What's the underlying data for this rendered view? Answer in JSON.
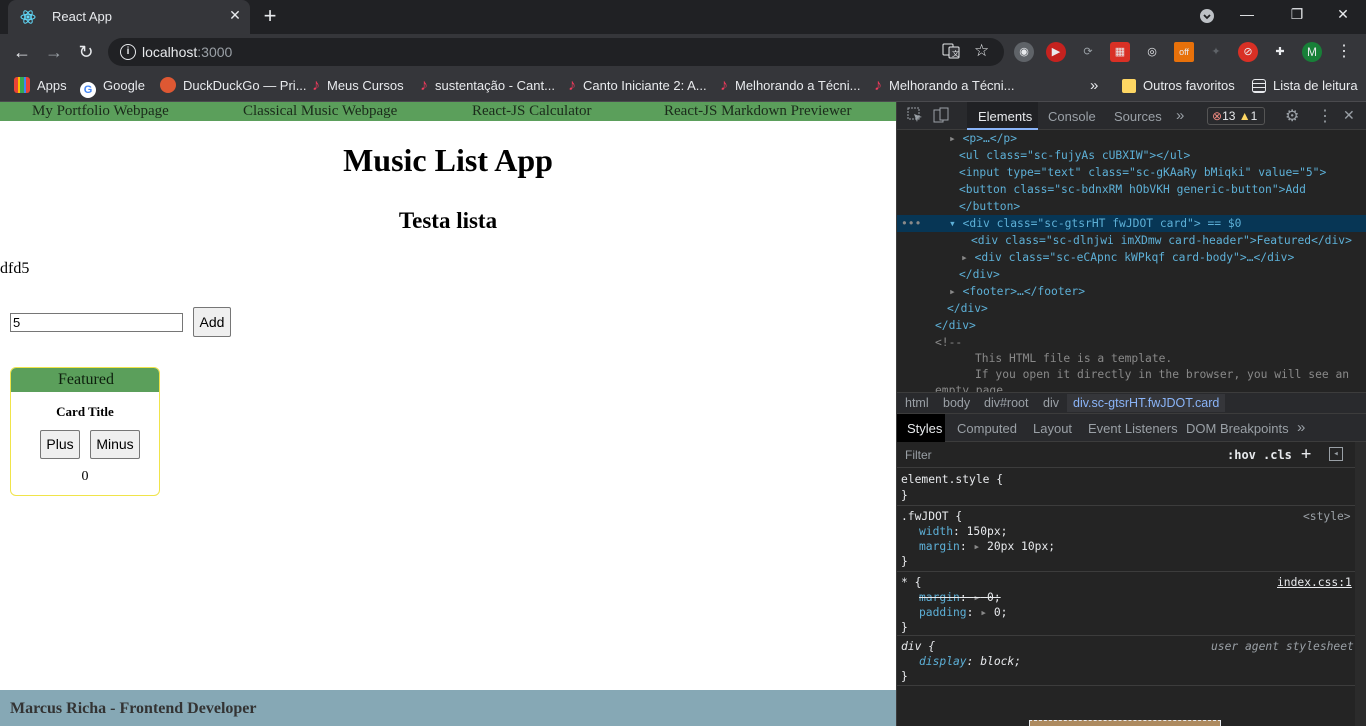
{
  "browser": {
    "tab_title": "React App",
    "url_host": "localhost",
    "url_port": ":3000",
    "profile_initial": "M",
    "ext_off_badge": "off"
  },
  "bookmarks": {
    "items": [
      {
        "label": "Apps",
        "icon": "apps-grid-icon"
      },
      {
        "label": "Google",
        "icon": "google-icon"
      },
      {
        "label": "DuckDuckGo — Pri...",
        "icon": "duckduckgo-icon"
      },
      {
        "label": "Meus Cursos",
        "icon": "music-note-icon"
      },
      {
        "label": "sustentação - Cant...",
        "icon": "music-note-icon"
      },
      {
        "label": "Canto Iniciante 2: A...",
        "icon": "music-note-icon"
      },
      {
        "label": "Melhorando a Técni...",
        "icon": "music-note-icon"
      },
      {
        "label": "Melhorando a Técni...",
        "icon": "music-note-icon"
      }
    ],
    "more": "»",
    "other_favorites": "Outros favoritos",
    "reading_list": "Lista de leitura"
  },
  "page": {
    "nav": [
      "My Portfolio Webpage",
      "Classical Music Webpage",
      "React-JS Calculator",
      "React-JS Markdown Previewer"
    ],
    "title": "Music List App",
    "subtitle": "Testa lista",
    "list_item": "dfd5",
    "input_value": "5",
    "add_label": "Add",
    "card": {
      "header": "Featured",
      "title": "Card Title",
      "plus_label": "Plus",
      "minus_label": "Minus",
      "count": "0"
    },
    "footer": "Marcus Richa - Frontend Developer"
  },
  "devtools": {
    "tabs": [
      "Elements",
      "Console",
      "Sources"
    ],
    "more_tabs": "»",
    "errors": "13",
    "warnings": "1",
    "dom_lines": [
      "<p>…</p>",
      "<ul class=\"sc-fujyAs cUBXIW\"></ul>",
      "<input type=\"text\" class=\"sc-gKAaRy bMiqki\" value=\"5\">",
      "<button class=\"sc-bdnxRM hObVKH generic-button\">Add",
      "</button>",
      "<div class=\"sc-gtsrHT fwJDOT card\"> == $0",
      "<div class=\"sc-dlnjwi imXDmw card-header\">Featured</div>",
      "<div class=\"sc-eCApnc kWPkqf card-body\">…</div>",
      "</div>",
      "<footer>…</footer>",
      "</div>",
      "</div>",
      "<!--",
      "This HTML file is a template.",
      "If you open it directly in the browser, you will see an",
      "empty page."
    ],
    "breadcrumbs": [
      "html",
      "body",
      "div#root",
      "div",
      "div.sc-gtsrHT.fwJDOT.card"
    ],
    "style_tabs": [
      "Styles",
      "Computed",
      "Layout",
      "Event Listeners",
      "DOM Breakpoints"
    ],
    "filter_placeholder": "Filter",
    "hov": ":hov",
    "cls": ".cls",
    "rules": {
      "element_style": "element.style {",
      "close": "}",
      "fw_selector": ".fwJDOT {",
      "fw_source": "<style>",
      "fw_width_name": "width",
      "fw_width_value": "150px;",
      "fw_margin_name": "margin",
      "fw_margin_value": "20px 10px;",
      "star_selector": "* {",
      "star_source": "index.css:1",
      "star_margin_name": "margin",
      "star_margin_value": "0;",
      "star_padding_name": "padding",
      "star_padding_value": "0;",
      "div_selector": "div {",
      "div_source": "user agent stylesheet",
      "div_display_name": "display",
      "div_display_value": "block;"
    }
  }
}
